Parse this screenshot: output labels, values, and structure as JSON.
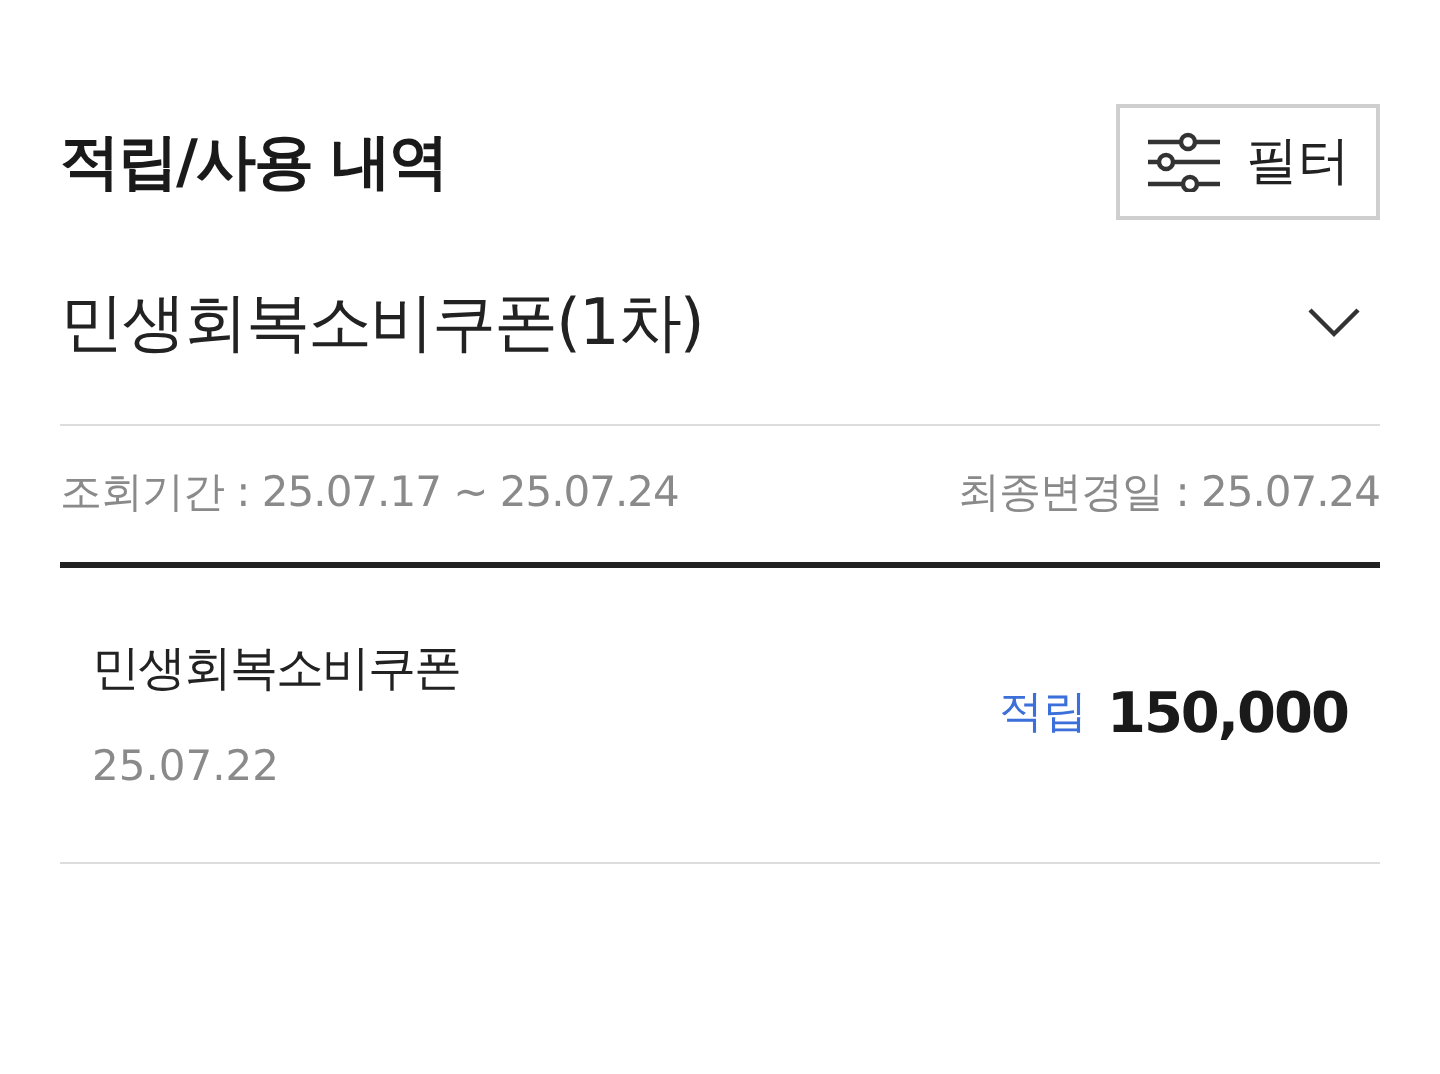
{
  "header": {
    "title": "적립/사용 내역",
    "filter_button": "필터"
  },
  "dropdown": {
    "value": "민생회복소비쿠폰(1차)",
    "expanded": false
  },
  "period": {
    "range": "조회기간 : 25.07.17 ~ 25.07.24",
    "last_updated": "최종변경일 : 25.07.24"
  },
  "transactions": [
    {
      "name": "민생회복소비쿠폰",
      "date": "25.07.22",
      "kind": "earn",
      "type_label": "적립",
      "amount": "150,000"
    }
  ]
}
